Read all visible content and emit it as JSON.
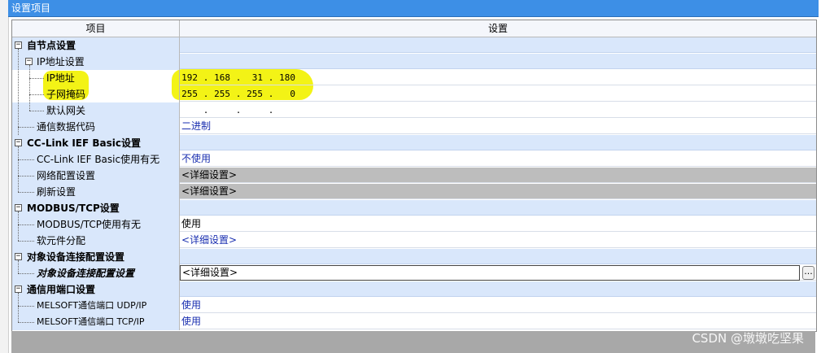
{
  "title_bar": "设置项目",
  "header": {
    "item": "项目",
    "setting": "设置"
  },
  "rows": [
    {
      "kind": "section",
      "label": "自节点设置",
      "value": ""
    },
    {
      "kind": "sub",
      "label": "IP地址设置",
      "value": ""
    },
    {
      "kind": "item2",
      "label": "IP地址",
      "ip": [
        "192",
        "168",
        "31",
        "180"
      ]
    },
    {
      "kind": "item2",
      "label": "子网掩码",
      "ip": [
        "255",
        "255",
        "255",
        "0"
      ]
    },
    {
      "kind": "item2",
      "label": "默认网关",
      "ip": [
        "",
        "",
        "",
        ""
      ]
    },
    {
      "kind": "item1",
      "label": "通信数据代码",
      "value": "二进制"
    },
    {
      "kind": "section",
      "label": "CC-Link IEF Basic设置",
      "value": ""
    },
    {
      "kind": "item1",
      "label": "CC-Link IEF Basic使用有无",
      "value": "不使用"
    },
    {
      "kind": "item1",
      "label": "网络配置设置",
      "value": "<详细设置>"
    },
    {
      "kind": "item1",
      "label": "刷新设置",
      "value": "<详细设置>"
    },
    {
      "kind": "section",
      "label": "MODBUS/TCP设置",
      "value": ""
    },
    {
      "kind": "item1",
      "label": "MODBUS/TCP使用有无",
      "value": "使用"
    },
    {
      "kind": "item1",
      "label": "软元件分配",
      "value": "<详细设置>"
    },
    {
      "kind": "section",
      "label": "对象设备连接配置设置",
      "value": ""
    },
    {
      "kind": "item1",
      "label": "对象设备连接配置设置",
      "value": "<详细设置>"
    },
    {
      "kind": "section",
      "label": "通信用端口设置",
      "value": ""
    },
    {
      "kind": "item1",
      "label": "MELSOFT通信端口 UDP/IP",
      "value": "使用"
    },
    {
      "kind": "item1",
      "label": "MELSOFT通信端口 TCP/IP",
      "value": "使用"
    }
  ],
  "dropdown_glyph": "...",
  "watermark": "CSDN @墩墩吃坚果",
  "colors": {
    "title_bar": "#3d8fe6",
    "section_bg": "#d9e7fb",
    "highlight": "#f2f20a",
    "link": "#1a2fb0",
    "disabled_bg": "#bdbdbd"
  }
}
